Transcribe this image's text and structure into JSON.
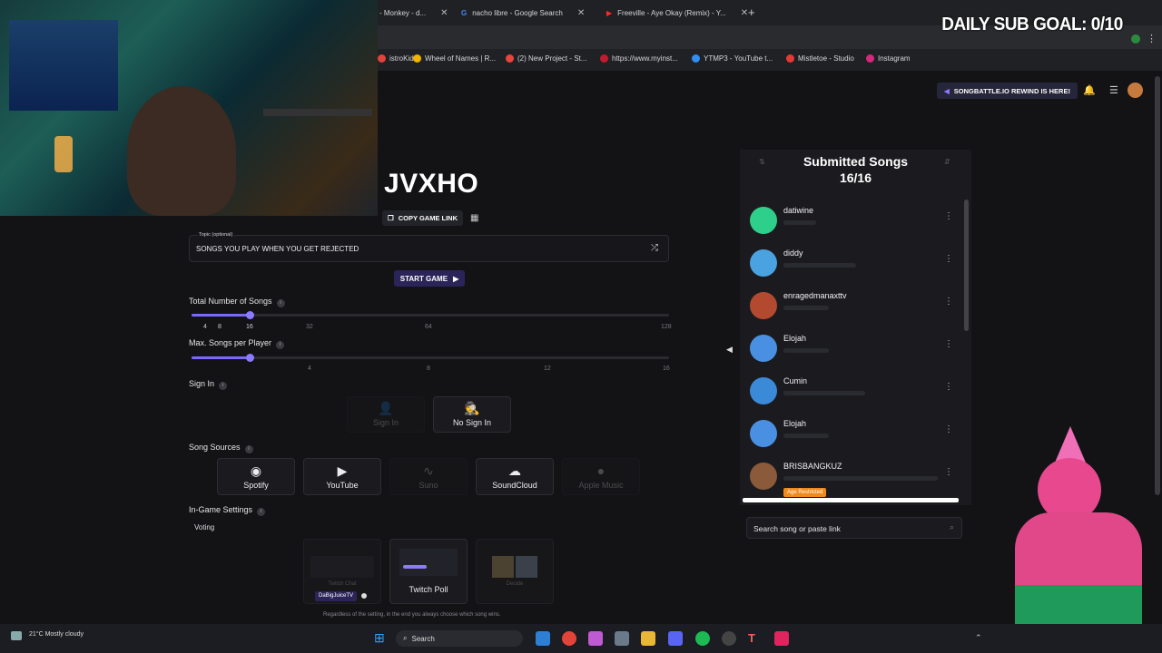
{
  "overlay": {
    "sub_goal": "DAILY SUB GOAL: 0/10"
  },
  "browser": {
    "tabs": [
      {
        "label": "- Monkey - d..."
      },
      {
        "label": "nacho libre - Google Search"
      },
      {
        "label": "Freeville - Aye Okay (Remix) - Y..."
      }
    ],
    "new_tab": "+",
    "bookmarks": [
      {
        "label": "istroKid",
        "color": "#e0443a"
      },
      {
        "label": "Wheel of Names | R...",
        "color": "#f2b400"
      },
      {
        "label": "(2) New Project - St...",
        "color": "#e8453c"
      },
      {
        "label": "https://www.myinst...",
        "color": "#c21c2c"
      },
      {
        "label": "YTMP3 - YouTube t...",
        "color": "#2f8ef0"
      },
      {
        "label": "Mistletoe - Studio",
        "color": "#e53935"
      },
      {
        "label": "Instagram",
        "color": "#d6287c"
      }
    ]
  },
  "header": {
    "banner": "SONGBATTLE.IO REWIND IS HERE!"
  },
  "game": {
    "title": "JVXHO",
    "copy_link": "COPY GAME LINK",
    "topic_label": "Topic (optional)",
    "topic_value": "SONGS YOU PLAY WHEN YOU GET REJECTED",
    "start": "START GAME",
    "total_songs": {
      "label": "Total Number of Songs",
      "ticks": [
        "4",
        "8",
        "16",
        "32",
        "64",
        "128"
      ],
      "value": 16
    },
    "max_songs": {
      "label": "Max. Songs per Player",
      "ticks": [
        "4",
        "8",
        "12",
        "16"
      ],
      "value": 1
    },
    "sign_in": {
      "label": "Sign In",
      "options": [
        {
          "label": "Sign In",
          "disabled": true
        },
        {
          "label": "No Sign In",
          "disabled": false
        }
      ]
    },
    "sources": {
      "label": "Song Sources",
      "options": [
        {
          "label": "Spotify",
          "icon": "spotify-icon",
          "disabled": false
        },
        {
          "label": "YouTube",
          "icon": "youtube-icon",
          "disabled": false
        },
        {
          "label": "Suno",
          "icon": "suno-icon",
          "disabled": true
        },
        {
          "label": "SoundCloud",
          "icon": "soundcloud-icon",
          "disabled": false
        },
        {
          "label": "Apple Music",
          "icon": "apple-icon",
          "disabled": true
        }
      ]
    },
    "ingame": {
      "label": "In-Game Settings",
      "voting_label": "Voting",
      "options": [
        {
          "label": "Twitch Chat",
          "user": "DaBigJuiceTV"
        },
        {
          "label": "Twitch Poll"
        },
        {
          "label": "Decide"
        }
      ],
      "note": "Regardless of the setting, in the end you always choose which song wins."
    }
  },
  "songs": {
    "title": "Submitted Songs",
    "count": "16/16",
    "items": [
      {
        "name": "datiwine",
        "color": "#2ecf8a"
      },
      {
        "name": "diddy",
        "color": "#4aa3e0"
      },
      {
        "name": "enragedmanaxttv",
        "color": "#b34a30"
      },
      {
        "name": "Elojah",
        "color": "#4a90e2"
      },
      {
        "name": "Cumin",
        "color": "#3b8ad8"
      },
      {
        "name": "Elojah",
        "color": "#4a90e2"
      },
      {
        "name": "BRISBANGKUZ",
        "color": "#8a5a3a",
        "badge": "Age Restricted"
      }
    ],
    "search_placeholder": "Search song or paste link"
  },
  "taskbar": {
    "weather": "21°C Mostly cloudy",
    "search": "Search"
  }
}
